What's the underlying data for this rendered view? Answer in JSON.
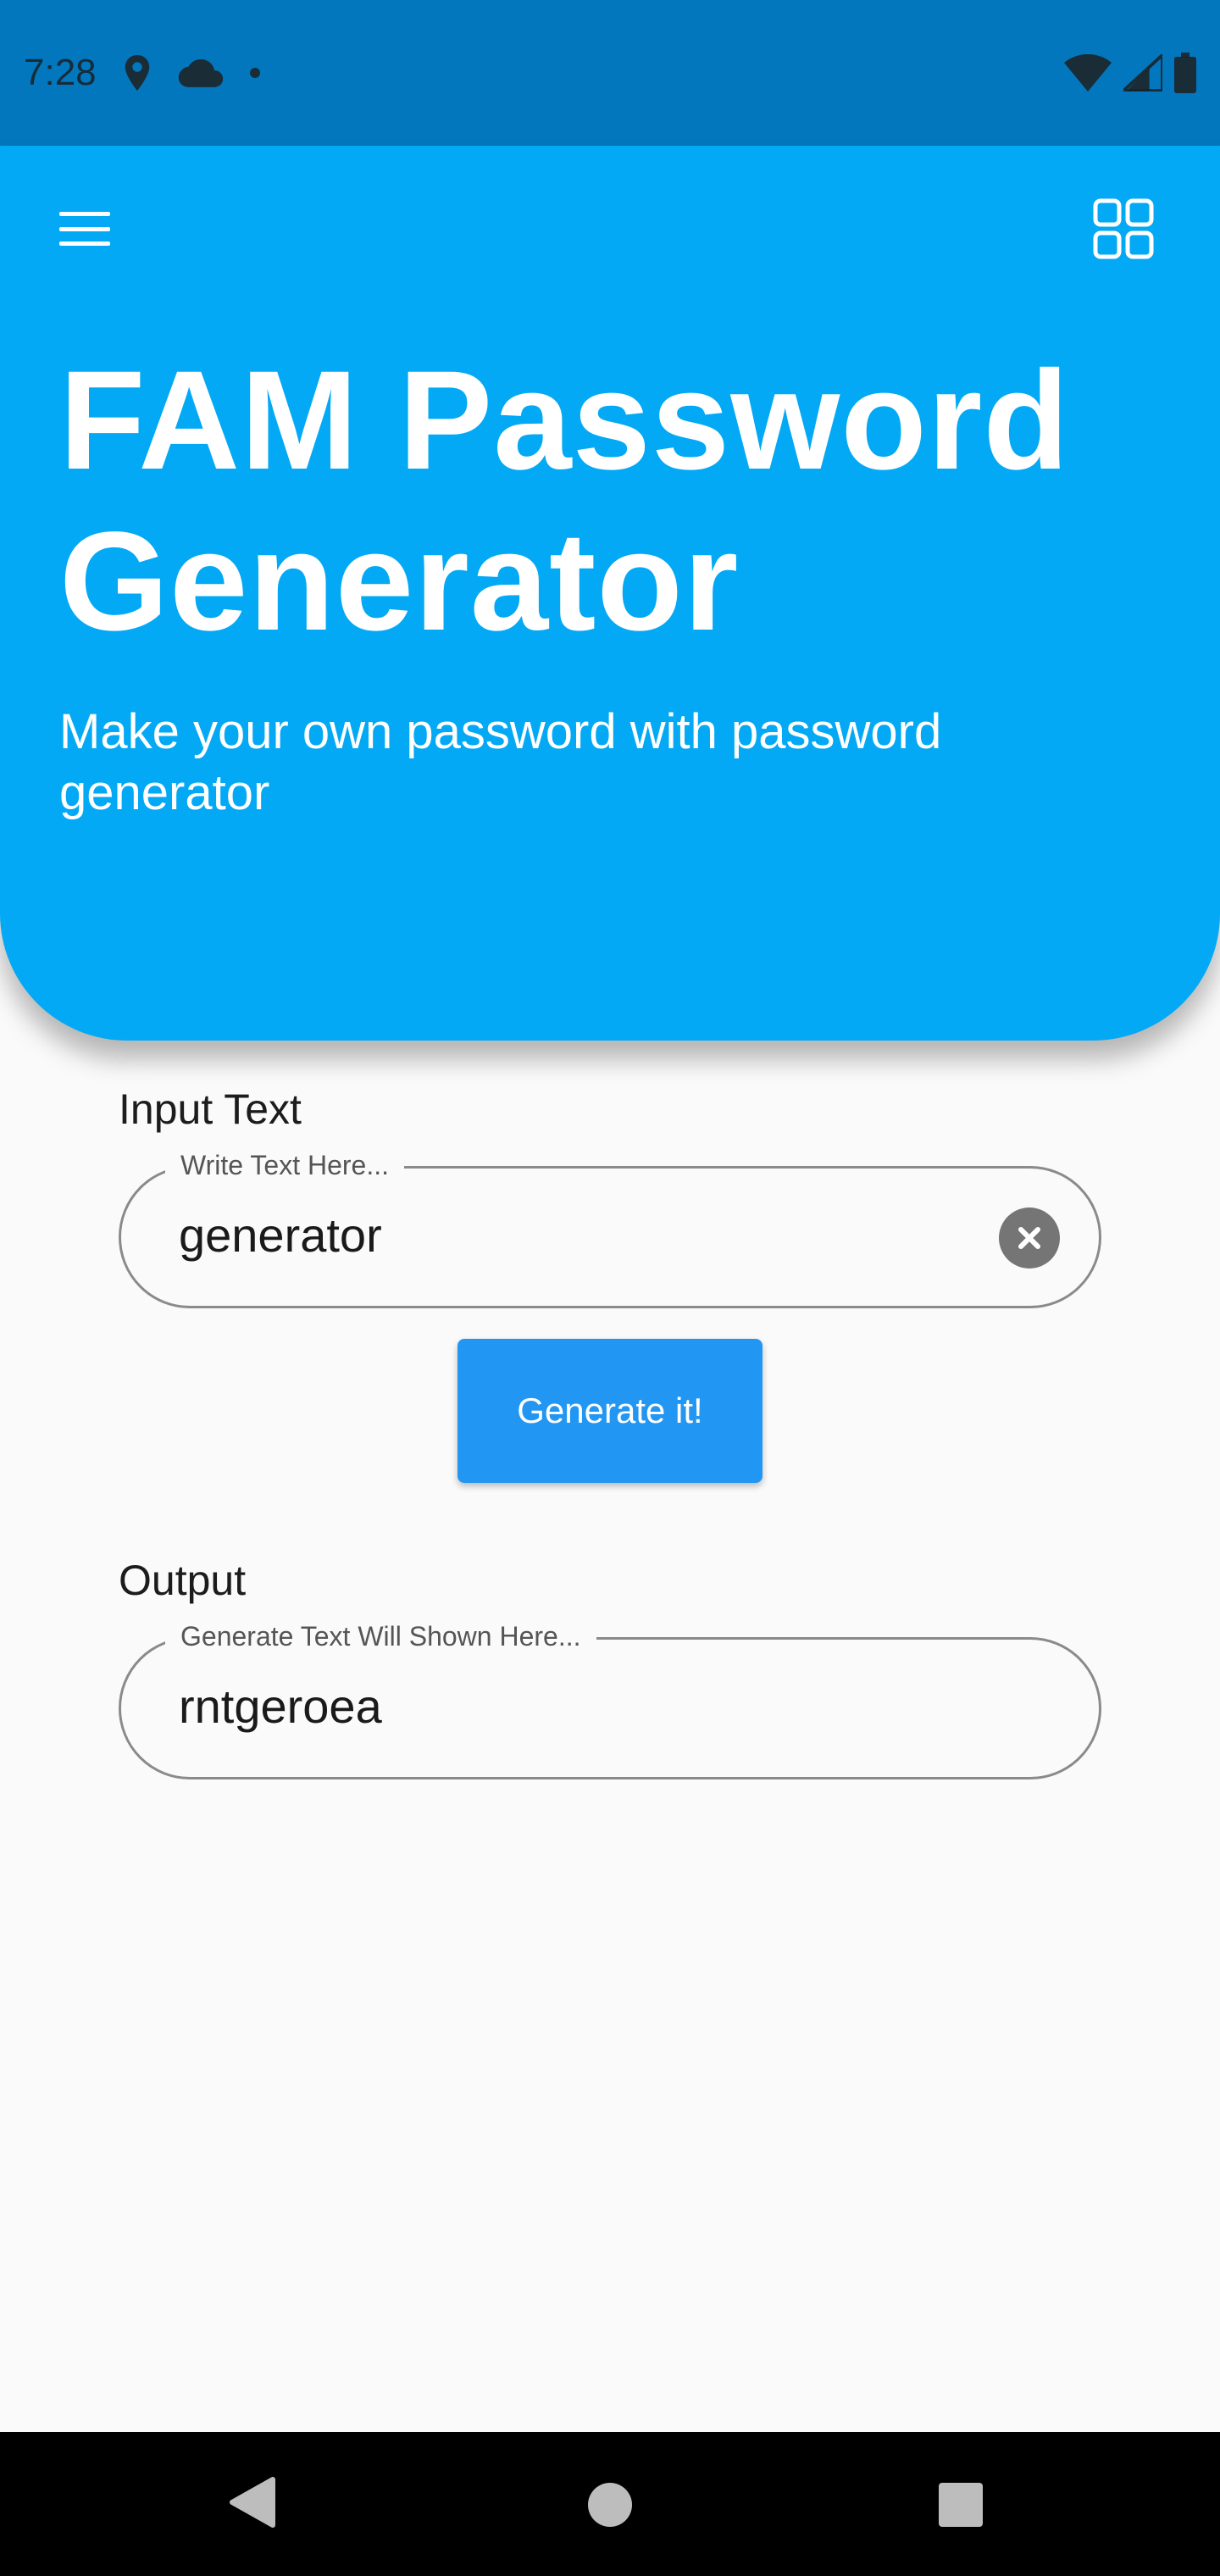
{
  "status_bar": {
    "time": "7:28",
    "left_icons": [
      "location-icon",
      "cloud-icon",
      "dot-icon"
    ],
    "right_icons": [
      "wifi-icon",
      "signal-icon",
      "battery-icon"
    ]
  },
  "header": {
    "title": "FAM Password Generator",
    "subtitle": "Make your own password with password generator",
    "menu_icon": "menu-icon",
    "grid_icon": "grid-icon"
  },
  "input_section": {
    "label": "Input Text",
    "field_label": "Write Text Here...",
    "value": "generator"
  },
  "generate_button": {
    "label": "Generate it!"
  },
  "output_section": {
    "label": "Output",
    "field_label": "Generate Text Will Shown Here...",
    "value": "rntgeroea"
  },
  "nav_bar": {
    "icons": [
      "back-icon",
      "home-icon",
      "recents-icon"
    ]
  },
  "colors": {
    "status_bar": "#0277bd",
    "header": "#03a9f4",
    "button": "#2196f3",
    "background": "#fafafa"
  }
}
